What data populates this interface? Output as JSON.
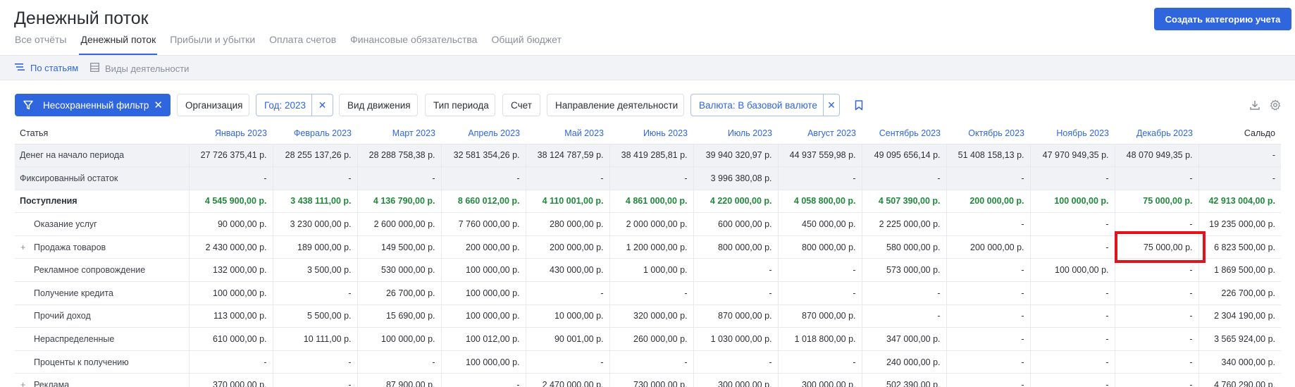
{
  "header": {
    "title": "Денежный поток",
    "create_button": "Создать категорию учета",
    "tabs": [
      "Все отчёты",
      "Денежный поток",
      "Прибыли и убытки",
      "Оплата счетов",
      "Финансовые обязательства",
      "Общий бюджет"
    ],
    "active_tab": 1
  },
  "subtabs": {
    "by_items": "По статьям",
    "by_activity": "Виды деятельности"
  },
  "filters": {
    "unsaved": "Несохраненный фильтр",
    "organization": "Организация",
    "year": "Год: 2023",
    "movement": "Вид движения",
    "period_type": "Тип периода",
    "account": "Счет",
    "direction": "Направление деятельности",
    "currency": "Валюта: В базовой валюте"
  },
  "colors": {
    "accent": "#2f66dd",
    "income": "#1f8a3b",
    "highlight": "#e0141e"
  },
  "table": {
    "columns": [
      "Статья",
      "Январь 2023",
      "Февраль 2023",
      "Март 2023",
      "Апрель 2023",
      "Май 2023",
      "Июнь 2023",
      "Июль 2023",
      "Август 2023",
      "Сентябрь 2023",
      "Октябрь 2023",
      "Ноябрь 2023",
      "Декабрь 2023",
      "Сальдо"
    ],
    "rows": [
      {
        "label": "Денег на начало периода",
        "style": "gray",
        "cells": [
          "27 726 375,41 р.",
          "28 255 137,26 р.",
          "28 288 758,38 р.",
          "32 581 354,26 р.",
          "38 124 787,59 р.",
          "38 419 285,81 р.",
          "39 940 320,97 р.",
          "44 937 559,98 р.",
          "49 095 656,14 р.",
          "51 408 158,13 р.",
          "47 970 949,35 р.",
          "48 070 949,35 р.",
          "-"
        ]
      },
      {
        "label": "Фиксированный остаток",
        "style": "gray",
        "cells": [
          "-",
          "-",
          "-",
          "-",
          "-",
          "-",
          "3 996 380,08 р.",
          "-",
          "-",
          "-",
          "-",
          "-",
          "-"
        ]
      },
      {
        "label": "Поступления",
        "style": "income",
        "cells": [
          "4 545 900,00 р.",
          "3 438 111,00 р.",
          "4 136 790,00 р.",
          "8 660 012,00 р.",
          "4 110 001,00 р.",
          "4 861 000,00 р.",
          "4 220 000,00 р.",
          "4 058 800,00 р.",
          "4 507 390,00 р.",
          "200 000,00 р.",
          "100 000,00 р.",
          "75 000,00 р.",
          "42 913 004,00 р."
        ]
      },
      {
        "label": "Оказание услуг",
        "style": "child",
        "cells": [
          "90 000,00 р.",
          "3 230 000,00 р.",
          "2 600 000,00 р.",
          "7 760 000,00 р.",
          "280 000,00 р.",
          "2 000 000,00 р.",
          "600 000,00 р.",
          "450 000,00 р.",
          "2 225 000,00 р.",
          "-",
          "-",
          "-",
          "19 235 000,00 р."
        ]
      },
      {
        "label": "Продажа товаров",
        "style": "child-expand",
        "cells": [
          "2 430 000,00 р.",
          "189 000,00 р.",
          "149 500,00 р.",
          "200 000,00 р.",
          "200 000,00 р.",
          "1 200 000,00 р.",
          "800 000,00 р.",
          "800 000,00 р.",
          "580 000,00 р.",
          "200 000,00 р.",
          "-",
          "75 000,00 р.",
          "6 823 500,00 р."
        ]
      },
      {
        "label": "Рекламное сопровождение",
        "style": "child",
        "cells": [
          "132 000,00 р.",
          "3 500,00 р.",
          "530 000,00 р.",
          "100 000,00 р.",
          "430 000,00 р.",
          "1 000,00 р.",
          "-",
          "-",
          "573 000,00 р.",
          "-",
          "100 000,00 р.",
          "-",
          "1 869 500,00 р."
        ]
      },
      {
        "label": "Получение кредита",
        "style": "child",
        "cells": [
          "100 000,00 р.",
          "-",
          "26 700,00 р.",
          "100 000,00 р.",
          "-",
          "-",
          "-",
          "-",
          "-",
          "-",
          "-",
          "-",
          "226 700,00 р."
        ]
      },
      {
        "label": "Прочий доход",
        "style": "child",
        "cells": [
          "113 000,00 р.",
          "5 500,00 р.",
          "15 690,00 р.",
          "100 000,00 р.",
          "10 000,00 р.",
          "320 000,00 р.",
          "870 000,00 р.",
          "870 000,00 р.",
          "-",
          "-",
          "-",
          "-",
          "2 304 190,00 р."
        ]
      },
      {
        "label": "Нераспределенные",
        "style": "child",
        "cells": [
          "610 000,00 р.",
          "10 111,00 р.",
          "100 000,00 р.",
          "100 012,00 р.",
          "90 001,00 р.",
          "260 000,00 р.",
          "1 030 000,00 р.",
          "1 018 800,00 р.",
          "347 000,00 р.",
          "-",
          "-",
          "-",
          "3 565 924,00 р."
        ]
      },
      {
        "label": "Проценты к получению",
        "style": "child",
        "cells": [
          "-",
          "-",
          "-",
          "100 000,00 р.",
          "-",
          "-",
          "-",
          "-",
          "240 000,00 р.",
          "-",
          "-",
          "-",
          "340 000,00 р."
        ]
      },
      {
        "label": "Реклама",
        "style": "child-expand",
        "cells": [
          "370 000,00 р.",
          "-",
          "87 900,00 р.",
          "-",
          "2 470 000,00 р.",
          "730 000,00 р.",
          "300 000,00 р.",
          "300 000,00 р.",
          "502 390,00 р.",
          "-",
          "-",
          "-",
          "4 760 290,00 р."
        ]
      }
    ]
  }
}
